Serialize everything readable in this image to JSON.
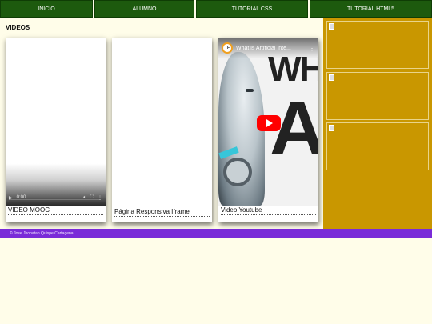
{
  "nav": {
    "items": [
      {
        "label": "INICIO"
      },
      {
        "label": "ALUMNO"
      },
      {
        "label": "TUTORIAL CSS"
      },
      {
        "label": "TUTORIAL HTML5"
      }
    ]
  },
  "main": {
    "section_title": "VIDEOS",
    "cards": [
      {
        "caption": "VIDEO MOOC",
        "player_time": "0:00"
      },
      {
        "caption": "Página Responsiva Iframe"
      },
      {
        "caption": "Video Youtube",
        "yt_title": "What is Artificial Inte...",
        "yt_channel_initials": "TF",
        "yt_thumb_text_1": "WH",
        "yt_thumb_text_2": "A."
      }
    ]
  },
  "footer": {
    "text": "© Jose Jhonatan Quispe Cartagena"
  },
  "colors": {
    "nav_bg": "#1d5a0e",
    "page_bg": "#fffde9",
    "sidebar_bg": "#c99700",
    "footer_bg": "#7a2bd8",
    "yt_red": "#ff0000"
  }
}
